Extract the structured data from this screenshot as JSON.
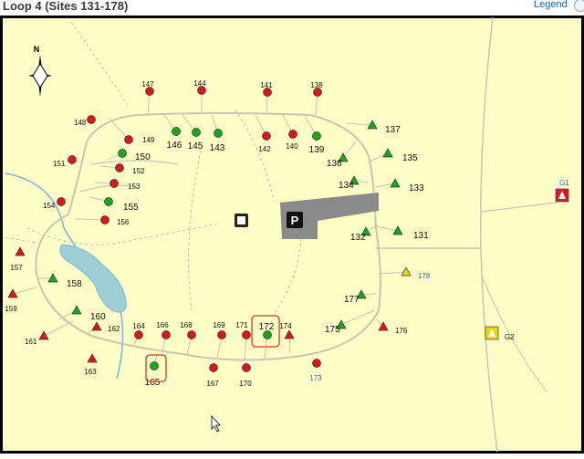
{
  "header": {
    "title": "Loop 4 (Sites 131-178)",
    "legend_label": "Legend",
    "legend_icon": "search-icon"
  },
  "map": {
    "parking_label": "P",
    "restroom_icon": "restroom-icon",
    "north_label": "N",
    "colors": {
      "background": "#fefdc8",
      "water": "#9ecfd6",
      "road": "#b0b0a0",
      "parking": "#8a8a8a",
      "available": "#1aa81a",
      "reserved": "#d8161b",
      "special": "#e6d800",
      "selected": "#d03a2a"
    },
    "sites": [
      {
        "label": "147",
        "status": "reserved",
        "shape": "circle"
      },
      {
        "label": "144",
        "status": "reserved",
        "shape": "circle"
      },
      {
        "label": "141",
        "status": "reserved",
        "shape": "circle"
      },
      {
        "label": "138",
        "status": "reserved",
        "shape": "circle"
      },
      {
        "label": "148",
        "status": "reserved",
        "shape": "circle"
      },
      {
        "label": "149",
        "status": "reserved",
        "shape": "circle"
      },
      {
        "label": "146",
        "status": "available",
        "shape": "circle"
      },
      {
        "label": "145",
        "status": "available",
        "shape": "circle"
      },
      {
        "label": "143",
        "status": "available",
        "shape": "circle"
      },
      {
        "label": "142",
        "status": "reserved",
        "shape": "circle"
      },
      {
        "label": "140",
        "status": "reserved",
        "shape": "circle"
      },
      {
        "label": "139",
        "status": "available",
        "shape": "circle"
      },
      {
        "label": "137",
        "status": "available",
        "shape": "triangle"
      },
      {
        "label": "150",
        "status": "available",
        "shape": "circle"
      },
      {
        "label": "151",
        "status": "reserved",
        "shape": "circle"
      },
      {
        "label": "152",
        "status": "reserved",
        "shape": "circle"
      },
      {
        "label": "136",
        "status": "available",
        "shape": "triangle"
      },
      {
        "label": "135",
        "status": "available",
        "shape": "triangle"
      },
      {
        "label": "153",
        "status": "reserved",
        "shape": "circle"
      },
      {
        "label": "134",
        "status": "available",
        "shape": "triangle"
      },
      {
        "label": "133",
        "status": "available",
        "shape": "triangle"
      },
      {
        "label": "154",
        "status": "reserved",
        "shape": "circle"
      },
      {
        "label": "155",
        "status": "available",
        "shape": "circle"
      },
      {
        "label": "156",
        "status": "reserved",
        "shape": "circle"
      },
      {
        "label": "132",
        "status": "available",
        "shape": "triangle"
      },
      {
        "label": "131",
        "status": "available",
        "shape": "triangle"
      },
      {
        "label": "157",
        "status": "reserved",
        "shape": "triangle"
      },
      {
        "label": "158",
        "status": "available",
        "shape": "triangle"
      },
      {
        "label": "178",
        "status": "special",
        "shape": "triangle"
      },
      {
        "label": "159",
        "status": "reserved",
        "shape": "triangle"
      },
      {
        "label": "177",
        "status": "available",
        "shape": "triangle"
      },
      {
        "label": "160",
        "status": "available",
        "shape": "triangle"
      },
      {
        "label": "162",
        "status": "reserved",
        "shape": "triangle"
      },
      {
        "label": "161",
        "status": "reserved",
        "shape": "triangle"
      },
      {
        "label": "175",
        "status": "available",
        "shape": "triangle"
      },
      {
        "label": "176",
        "status": "reserved",
        "shape": "triangle"
      },
      {
        "label": "164",
        "status": "reserved",
        "shape": "circle"
      },
      {
        "label": "166",
        "status": "reserved",
        "shape": "circle"
      },
      {
        "label": "168",
        "status": "reserved",
        "shape": "circle"
      },
      {
        "label": "169",
        "status": "reserved",
        "shape": "circle"
      },
      {
        "label": "171",
        "status": "reserved",
        "shape": "circle"
      },
      {
        "label": "172",
        "status": "available",
        "shape": "circle"
      },
      {
        "label": "174",
        "status": "reserved",
        "shape": "triangle"
      },
      {
        "label": "163",
        "status": "reserved",
        "shape": "triangle"
      },
      {
        "label": "165",
        "status": "available",
        "shape": "circle"
      },
      {
        "label": "167",
        "status": "reserved",
        "shape": "circle"
      },
      {
        "label": "170",
        "status": "reserved",
        "shape": "circle"
      },
      {
        "label": "173",
        "status": "reserved",
        "shape": "circle"
      }
    ],
    "group_sites": [
      {
        "label": "G1",
        "status": "reserved"
      },
      {
        "label": "G2",
        "status": "special"
      }
    ]
  }
}
